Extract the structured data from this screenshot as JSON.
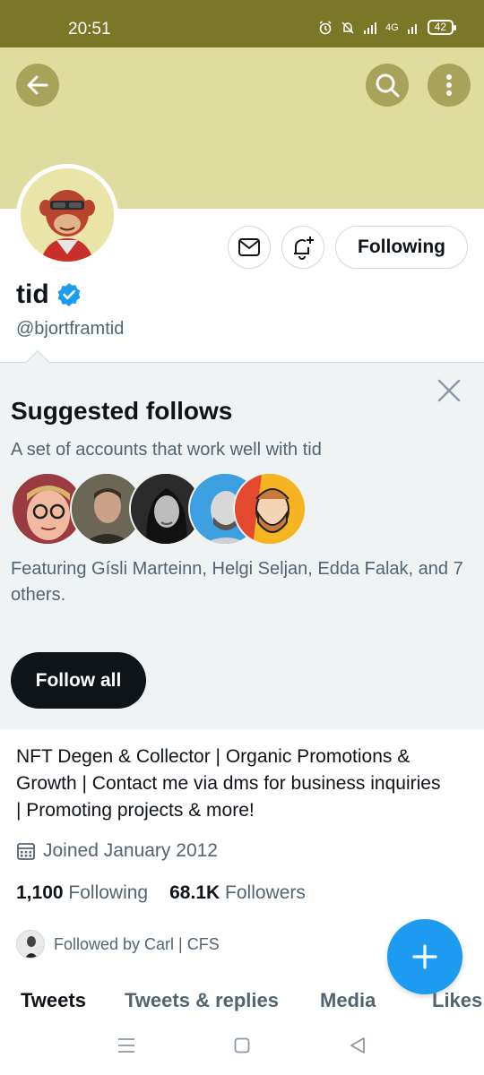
{
  "status_bar": {
    "time": "20:51",
    "network": "4G",
    "battery": "42"
  },
  "header": {
    "back_icon": "arrow-left-icon",
    "search_icon": "search-icon",
    "more_icon": "more-vertical-icon",
    "banner_color": "#dedd9f"
  },
  "profile": {
    "display_name": "tid",
    "verified": true,
    "handle": "@bjortframtid",
    "following_label": "Following",
    "bio": "NFT Degen & Collector | Organic Promotions & Growth | Contact me via dms for business inquiries | Promoting projects & more!",
    "joined": "Joined January 2012",
    "following_count": "1,100",
    "following_label_stat": "Following",
    "followers_count": "68.1K",
    "followers_label": "Followers",
    "followed_by": "Followed by Carl | CFS"
  },
  "suggested": {
    "title": "Suggested follows",
    "subtitle": "A set of accounts that work well with tid",
    "featuring": "Featuring Gísli Marteinn, Helgi Seljan, Edda Falak, and 7 others.",
    "follow_all_label": "Follow all"
  },
  "tabs": [
    {
      "label": "Tweets",
      "active": true
    },
    {
      "label": "Tweets & replies",
      "active": false
    },
    {
      "label": "Media",
      "active": false
    },
    {
      "label": "Likes",
      "active": false
    }
  ],
  "colors": {
    "accent": "#1d9bf0",
    "status_bar": "#7a7726",
    "header_button": "#a8a35b"
  }
}
